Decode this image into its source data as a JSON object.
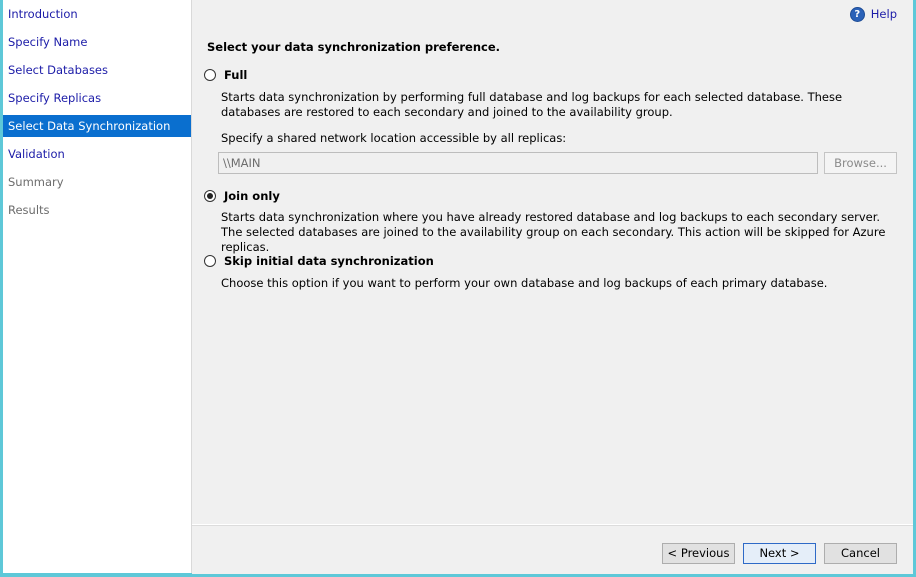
{
  "sidebar": {
    "items": [
      {
        "label": "Introduction",
        "state": "link"
      },
      {
        "label": "Specify Name",
        "state": "link"
      },
      {
        "label": "Select Databases",
        "state": "link"
      },
      {
        "label": "Specify Replicas",
        "state": "link"
      },
      {
        "label": "Select Data Synchronization",
        "state": "active"
      },
      {
        "label": "Validation",
        "state": "link"
      },
      {
        "label": "Summary",
        "state": "disabled"
      },
      {
        "label": "Results",
        "state": "disabled"
      }
    ]
  },
  "header": {
    "help_label": "Help",
    "help_icon": "help-circle-icon"
  },
  "main": {
    "heading": "Select your data synchronization preference.",
    "options": [
      {
        "label": "Full",
        "selected": false,
        "description": "Starts data synchronization by performing full database and log backups for each selected database. These databases are restored to each secondary and joined to the availability group."
      },
      {
        "label": "Join only",
        "selected": true,
        "description": "Starts data synchronization where you have already restored database and log backups to each secondary server. The selected databases are joined to the availability group on each secondary. This action will be skipped for Azure replicas."
      },
      {
        "label": "Skip initial data synchronization",
        "selected": false,
        "description": "Choose this option if you want to perform your own database and log backups of each primary database."
      }
    ],
    "network_location": {
      "label": "Specify a shared network location accessible by all replicas:",
      "value": "\\\\MAIN",
      "browse_label": "Browse..."
    }
  },
  "footer": {
    "previous_label": "< Previous",
    "next_label": "Next >",
    "cancel_label": "Cancel"
  },
  "colors": {
    "accent": "#0a6fcf",
    "link": "#1c1ca8",
    "frame": "#5ec8d8"
  }
}
